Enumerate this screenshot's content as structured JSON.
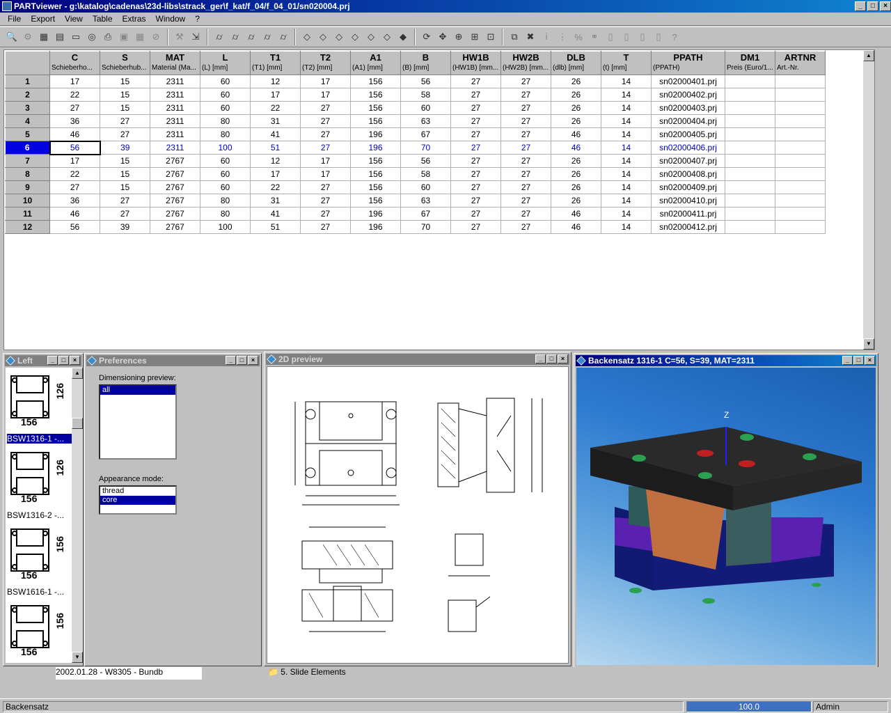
{
  "window": {
    "title": "PARTviewer - g:\\katalog\\cadenas\\23d-libs\\strack_ger\\f_kat/f_04/f_04_01/sn020004.prj"
  },
  "menu": [
    "File",
    "Export",
    "View",
    "Table",
    "Extras",
    "Window",
    "?"
  ],
  "table": {
    "columns": [
      {
        "code": "C",
        "desc": "Schieberho..."
      },
      {
        "code": "S",
        "desc": "Schieberhub..."
      },
      {
        "code": "MAT",
        "desc": "Material (Ma..."
      },
      {
        "code": "L",
        "desc": "(L) [mm]"
      },
      {
        "code": "T1",
        "desc": "(T1) [mm]"
      },
      {
        "code": "T2",
        "desc": "(T2) [mm]"
      },
      {
        "code": "A1",
        "desc": "(A1) [mm]"
      },
      {
        "code": "B",
        "desc": "(B) [mm]"
      },
      {
        "code": "HW1B",
        "desc": "(HW1B) [mm..."
      },
      {
        "code": "HW2B",
        "desc": "(HW2B) [mm..."
      },
      {
        "code": "DLB",
        "desc": "(dlb) [mm]"
      },
      {
        "code": "T",
        "desc": "(t) [mm]"
      },
      {
        "code": "PPATH",
        "desc": "(PPATH)"
      },
      {
        "code": "DM1",
        "desc": "Preis (Euro/1..."
      },
      {
        "code": "ARTNR",
        "desc": "Art.-Nr."
      }
    ],
    "rows": [
      [
        "1",
        "17",
        "15",
        "2311",
        "60",
        "12",
        "17",
        "156",
        "56",
        "27",
        "27",
        "26",
        "14",
        "sn02000401.prj",
        "",
        ""
      ],
      [
        "2",
        "22",
        "15",
        "2311",
        "60",
        "17",
        "17",
        "156",
        "58",
        "27",
        "27",
        "26",
        "14",
        "sn02000402.prj",
        "",
        ""
      ],
      [
        "3",
        "27",
        "15",
        "2311",
        "60",
        "22",
        "27",
        "156",
        "60",
        "27",
        "27",
        "26",
        "14",
        "sn02000403.prj",
        "",
        ""
      ],
      [
        "4",
        "36",
        "27",
        "2311",
        "80",
        "31",
        "27",
        "156",
        "63",
        "27",
        "27",
        "26",
        "14",
        "sn02000404.prj",
        "",
        ""
      ],
      [
        "5",
        "46",
        "27",
        "2311",
        "80",
        "41",
        "27",
        "196",
        "67",
        "27",
        "27",
        "46",
        "14",
        "sn02000405.prj",
        "",
        ""
      ],
      [
        "6",
        "56",
        "39",
        "2311",
        "100",
        "51",
        "27",
        "196",
        "70",
        "27",
        "27",
        "46",
        "14",
        "sn02000406.prj",
        "",
        ""
      ],
      [
        "7",
        "17",
        "15",
        "2767",
        "60",
        "12",
        "17",
        "156",
        "56",
        "27",
        "27",
        "26",
        "14",
        "sn02000407.prj",
        "",
        ""
      ],
      [
        "8",
        "22",
        "15",
        "2767",
        "60",
        "17",
        "17",
        "156",
        "58",
        "27",
        "27",
        "26",
        "14",
        "sn02000408.prj",
        "",
        ""
      ],
      [
        "9",
        "27",
        "15",
        "2767",
        "60",
        "22",
        "27",
        "156",
        "60",
        "27",
        "27",
        "26",
        "14",
        "sn02000409.prj",
        "",
        ""
      ],
      [
        "10",
        "36",
        "27",
        "2767",
        "80",
        "31",
        "27",
        "156",
        "63",
        "27",
        "27",
        "26",
        "14",
        "sn02000410.prj",
        "",
        ""
      ],
      [
        "11",
        "46",
        "27",
        "2767",
        "80",
        "41",
        "27",
        "196",
        "67",
        "27",
        "27",
        "46",
        "14",
        "sn02000411.prj",
        "",
        ""
      ],
      [
        "12",
        "56",
        "39",
        "2767",
        "100",
        "51",
        "27",
        "196",
        "70",
        "27",
        "27",
        "46",
        "14",
        "sn02000412.prj",
        "",
        ""
      ]
    ],
    "selected_row": 6
  },
  "left_panel": {
    "title": "Left",
    "items": [
      {
        "label": "BSW1316-1 -...",
        "dim_side": "126",
        "dim_bottom": "156"
      },
      {
        "label": "BSW1316-2 -...",
        "dim_side": "126",
        "dim_bottom": "156"
      },
      {
        "label": "BSW1616-1 -...",
        "dim_side": "156",
        "dim_bottom": "156"
      },
      {
        "label": "",
        "dim_side": "156",
        "dim_bottom": "156"
      }
    ]
  },
  "preferences": {
    "title": "Preferences",
    "dim_label": "Dimensioning preview:",
    "dim_options": [
      "all"
    ],
    "app_label": "Appearance mode:",
    "app_options": [
      "thread",
      "core"
    ],
    "app_selected": "core"
  },
  "preview2d": {
    "title": "2D preview"
  },
  "view3d": {
    "title": "Backensatz 1316-1 C=56, S=39, MAT=2311",
    "axis": "Z"
  },
  "bottom": {
    "left_text": "2002.01.28 - W8305 -  Bundb",
    "tree_item": "5. Slide Elements"
  },
  "status": {
    "text": "Backensatz",
    "progress": "100.0",
    "user": "Admin"
  },
  "colors": {
    "accent": "#000080",
    "model_top": "#2a2a2a",
    "model_purple": "#5a20b0",
    "model_navy": "#101a70",
    "model_green": "#2aa050"
  }
}
